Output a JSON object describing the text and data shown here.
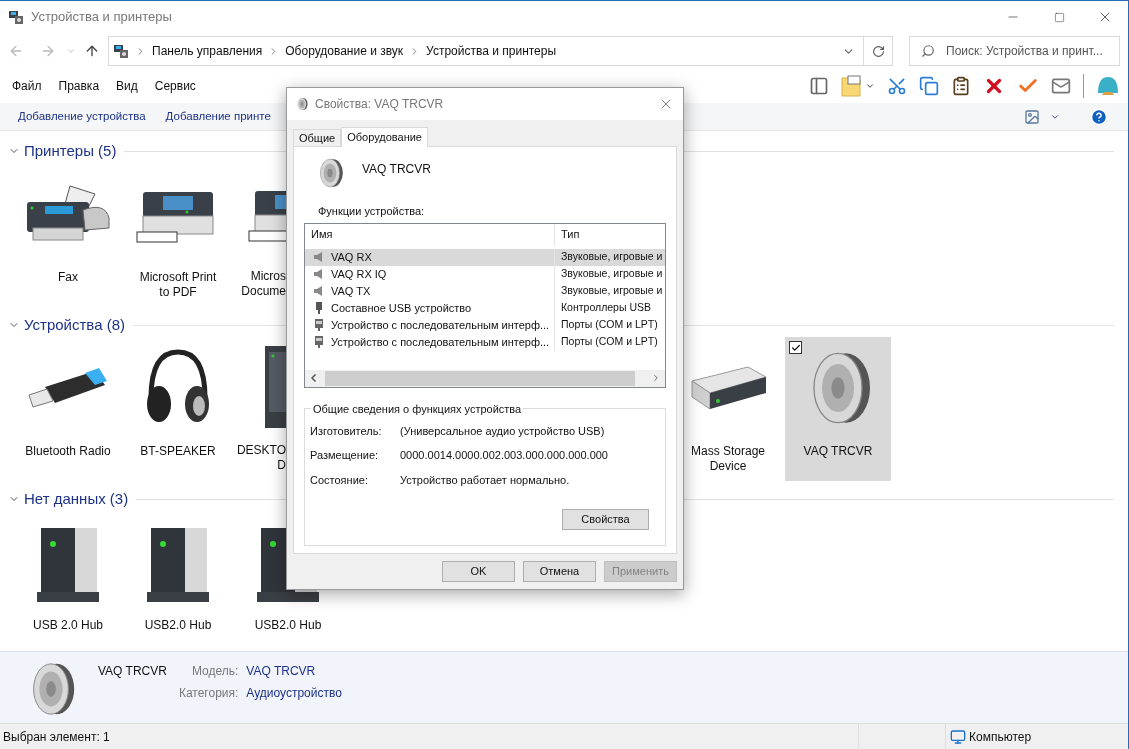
{
  "window": {
    "title": "Устройства и принтеры"
  },
  "address_bar": {
    "path": [
      "Панель управления",
      "Оборудование и звук",
      "Устройства и принтеры"
    ]
  },
  "search": {
    "placeholder": "Поиск: Устройства и принт..."
  },
  "menu": [
    "Файл",
    "Правка",
    "Вид",
    "Сервис"
  ],
  "commands": [
    "Добавление устройства",
    "Добавление принте"
  ],
  "groups": [
    {
      "title": "Принтеры (5)",
      "expanded": true,
      "items": [
        {
          "kind": "fax",
          "label": [
            "Fax"
          ],
          "clipped": false,
          "selected": false,
          "checked": false
        },
        {
          "kind": "printer",
          "label": [
            "Microsoft Print",
            "to PDF"
          ],
          "clipped": false,
          "selected": false,
          "checked": false
        },
        {
          "kind": "printer",
          "label": [
            "Micros",
            "Docume"
          ],
          "clipped": true,
          "selected": false,
          "checked": false
        }
      ]
    },
    {
      "title": "Устройства (8)",
      "expanded": true,
      "items": [
        {
          "kind": "usb-stick",
          "label": [
            "Bluetooth Radio"
          ],
          "clipped": false,
          "selected": false,
          "checked": false
        },
        {
          "kind": "headphones",
          "label": [
            "BT-SPEAKER"
          ],
          "clipped": false,
          "selected": false,
          "checked": false
        },
        {
          "kind": "tower",
          "label": [
            "DESKTO",
            "D"
          ],
          "clipped": true,
          "selected": false,
          "checked": false
        },
        {
          "kind": "drive",
          "label": [
            "Mass Storage",
            "Device"
          ],
          "clipped": false,
          "selected": false,
          "checked": false
        },
        {
          "kind": "speaker",
          "label": [
            "VAQ TRCVR"
          ],
          "clipped": false,
          "selected": true,
          "checked": true
        }
      ]
    },
    {
      "title": "Нет данных (3)",
      "expanded": true,
      "items": [
        {
          "kind": "hub",
          "label": [
            "USB 2.0 Hub"
          ],
          "clipped": false,
          "selected": false,
          "checked": false
        },
        {
          "kind": "hub",
          "label": [
            "USB2.0 Hub"
          ],
          "clipped": false,
          "selected": false,
          "checked": false
        },
        {
          "kind": "hub",
          "label": [
            "USB2.0 Hub"
          ],
          "clipped": false,
          "selected": false,
          "checked": false
        }
      ]
    }
  ],
  "dialog": {
    "title": "Свойства: VAQ TRCVR",
    "tabs": [
      {
        "label": "Общие",
        "selected": false
      },
      {
        "label": "Оборудование",
        "selected": true
      }
    ],
    "device_name": "VAQ TRCVR",
    "functions_label": "Функции устройства:",
    "columns": [
      "Имя",
      "Тип"
    ],
    "rows": [
      {
        "kind": "speaker",
        "name": "VAQ RX",
        "type": "Звуковые, игровые и",
        "selected": true
      },
      {
        "kind": "speaker",
        "name": "VAQ RX IQ",
        "type": "Звуковые, игровые и",
        "selected": false
      },
      {
        "kind": "speaker",
        "name": "VAQ TX",
        "type": "Звуковые, игровые и",
        "selected": false
      },
      {
        "kind": "usb",
        "name": "Составное USB устройство",
        "type": "Контроллеры USB",
        "selected": false
      },
      {
        "kind": "port",
        "name": "Устройство с последовательным интерф...",
        "type": "Порты (COM и LPT)",
        "selected": false
      },
      {
        "kind": "port",
        "name": "Устройство с последовательным интерф...",
        "type": "Порты (COM и LPT)",
        "selected": false
      }
    ],
    "summary": {
      "legend": "Общие сведения о функциях устройства",
      "fields": [
        {
          "label": "Изготовитель:",
          "value": "(Универсальное аудио устройство USB)"
        },
        {
          "label": "Размещение:",
          "value": "0000.0014.0000.002.003.000.000.000.000"
        },
        {
          "label": "Состояние:",
          "value": "Устройство работает нормально."
        }
      ],
      "button": "Свойства"
    },
    "buttons": [
      {
        "label": "OK",
        "disabled": false
      },
      {
        "label": "Отмена",
        "disabled": false
      },
      {
        "label": "Применить",
        "disabled": true
      }
    ]
  },
  "details": {
    "name": "VAQ TRCVR",
    "fields": [
      {
        "label": "Модель:",
        "value": "VAQ TRCVR"
      },
      {
        "label": "Категория:",
        "value": "Аудиоустройство"
      }
    ]
  },
  "status_bar": {
    "text": "Выбран элемент: 1",
    "location": "Компьютер"
  }
}
